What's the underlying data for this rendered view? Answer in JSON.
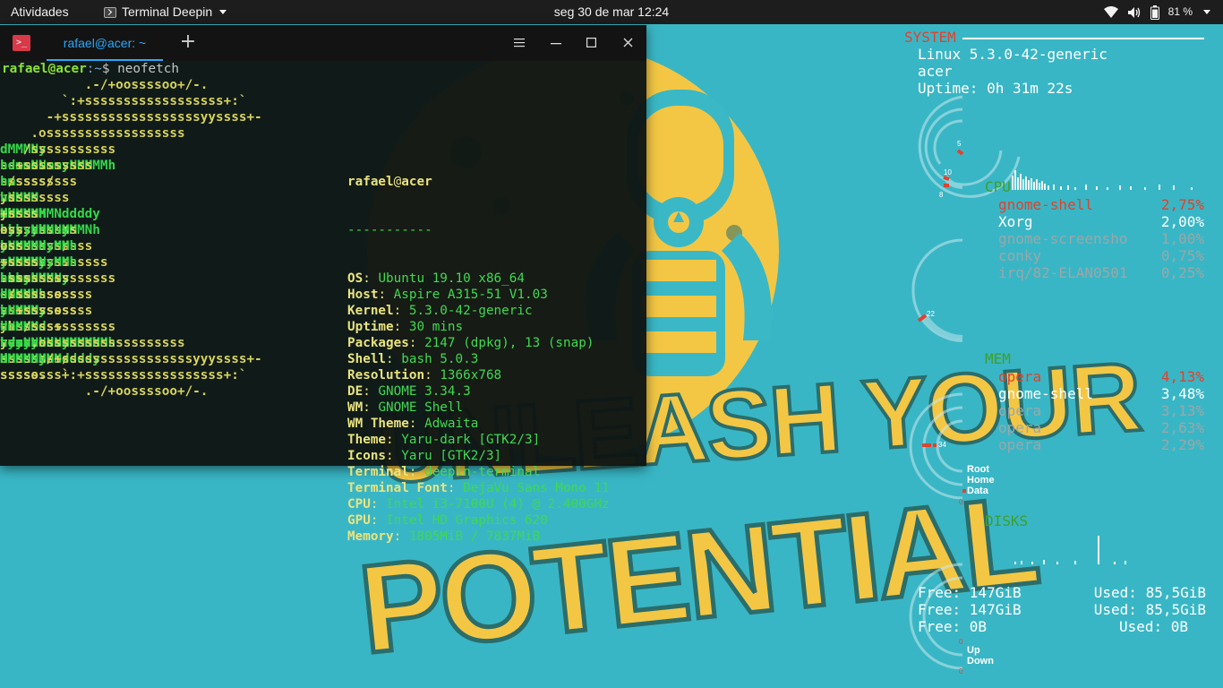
{
  "topbar": {
    "activities": "Atividades",
    "app_name": "Terminal Deepin",
    "clock": "seg 30 de mar  12:24",
    "battery": "81 %",
    "icons": [
      "terminal-app-icon",
      "wifi-icon",
      "volume-icon",
      "battery-icon",
      "chevron-down-icon"
    ]
  },
  "wallpaper": {
    "text_line1": "UNLEASH YOUR",
    "text_line2": "POTENTIAL",
    "colors": {
      "background": "#39b6c5",
      "yellow": "#f3c744",
      "dark": "#1f3a3a"
    }
  },
  "terminal": {
    "tab_title": "rafael@acer: ~",
    "prompt": {
      "user": "rafael@acer",
      "path": ":~",
      "symbol": "$ ",
      "command": "neofetch"
    },
    "logo": [
      [
        [
          "y",
          "           .-/+oossssoo+/-."
        ]
      ],
      [
        [
          "y",
          "        `:+ssssssssssssssssss+:`"
        ]
      ],
      [
        [
          "y",
          "      -+ssssssssssssssssssyyssss+-"
        ]
      ],
      [
        [
          "y",
          "    .ossssssssssssssssss"
        ],
        [
          "g",
          "dMMMNy"
        ],
        [
          "y",
          "sssso."
        ]
      ],
      [
        [
          "y",
          "   /sssssssssss"
        ],
        [
          "g",
          "hdmmNNmmyNMMMMh"
        ],
        [
          "y",
          "ssssss/"
        ]
      ],
      [
        [
          "y",
          "  +sssssssss"
        ],
        [
          "g",
          "hm"
        ],
        [
          "y",
          "yd"
        ],
        [
          "g",
          "MMMMMMMNddddy"
        ],
        [
          "y",
          "ssssssss+"
        ]
      ],
      [
        [
          "y",
          " /ssssssss"
        ],
        [
          "g",
          "hNMMM"
        ],
        [
          "y",
          "yh"
        ],
        [
          "g",
          "hyyyyhmNMMMNh"
        ],
        [
          "y",
          "ssssssss/"
        ]
      ],
      [
        [
          "y",
          ".ssssssss"
        ],
        [
          "g",
          "dMMMNh"
        ],
        [
          "y",
          "ssssssssss"
        ],
        [
          "g",
          "hNMMMd"
        ],
        [
          "y",
          "ssssssss."
        ]
      ],
      [
        [
          "y",
          "+ssss"
        ],
        [
          "g",
          "hhhyNMMNy"
        ],
        [
          "y",
          "ssssssssssss"
        ],
        [
          "g",
          "yNMMMy"
        ],
        [
          "y",
          "sssssss+"
        ]
      ],
      [
        [
          "y",
          "oss"
        ],
        [
          "g",
          "yNMMMNyMMh"
        ],
        [
          "y",
          "ssssssssssssss"
        ],
        [
          "g",
          "hmmmh"
        ],
        [
          "y",
          "ssssssso"
        ]
      ],
      [
        [
          "y",
          "oss"
        ],
        [
          "g",
          "yNMMMNyMMh"
        ],
        [
          "y",
          "sssssssssssssss"
        ],
        [
          "g",
          "hmmmh"
        ],
        [
          "y",
          "ssssssso"
        ]
      ],
      [
        [
          "y",
          "+ssss"
        ],
        [
          "g",
          "hhhyNMMNy"
        ],
        [
          "y",
          "ssssssssssss"
        ],
        [
          "g",
          "yNMMMy"
        ],
        [
          "y",
          "sssssss+"
        ]
      ],
      [
        [
          "y",
          ".ssssssss"
        ],
        [
          "g",
          "dMMMNh"
        ],
        [
          "y",
          "ssssssssss"
        ],
        [
          "g",
          "hNMMMd"
        ],
        [
          "y",
          "ssssssss."
        ]
      ],
      [
        [
          "y",
          " /ssssssss"
        ],
        [
          "g",
          "hNMMM"
        ],
        [
          "y",
          "yh"
        ],
        [
          "g",
          "hyyyyhdNMMMNh"
        ],
        [
          "y",
          "ssssssss/"
        ]
      ],
      [
        [
          "y",
          "  +sssssssss"
        ],
        [
          "g",
          "dm"
        ],
        [
          "y",
          "yd"
        ],
        [
          "g",
          "MMMMMMMMddddy"
        ],
        [
          "y",
          "ssssssss+"
        ]
      ],
      [
        [
          "y",
          "   /sssssssssss"
        ],
        [
          "g",
          "hdmNNNNmyNMMMMh"
        ],
        [
          "y",
          "ssssss/"
        ]
      ],
      [
        [
          "y",
          "    .ossssssssssssssssss"
        ],
        [
          "g",
          "dMMMNy"
        ],
        [
          "y",
          "sssso."
        ]
      ],
      [
        [
          "y",
          "      -+sssssssssssssssssyyyssss+-"
        ]
      ],
      [
        [
          "y",
          "        `:+ssssssssssssssssss+:`"
        ]
      ],
      [
        [
          "y",
          "           .-/+oossssoo+/-."
        ]
      ]
    ],
    "info_user": "rafael",
    "info_at": "@",
    "info_host": "acer",
    "info_separator": "-----------",
    "info": [
      {
        "key": "OS",
        "value": "Ubuntu 19.10 x86_64"
      },
      {
        "key": "Host",
        "value": "Aspire A315-51 V1.03"
      },
      {
        "key": "Kernel",
        "value": "5.3.0-42-generic"
      },
      {
        "key": "Uptime",
        "value": "30 mins"
      },
      {
        "key": "Packages",
        "value": "2147 (dpkg), 13 (snap)"
      },
      {
        "key": "Shell",
        "value": "bash 5.0.3"
      },
      {
        "key": "Resolution",
        "value": "1366x768"
      },
      {
        "key": "DE",
        "value": "GNOME 3.34.3"
      },
      {
        "key": "WM",
        "value": "GNOME Shell"
      },
      {
        "key": "WM Theme",
        "value": "Adwaita"
      },
      {
        "key": "Theme",
        "value": "Yaru-dark [GTK2/3]"
      },
      {
        "key": "Icons",
        "value": "Yaru [GTK2/3]"
      },
      {
        "key": "Terminal",
        "value": "deepin-terminal"
      },
      {
        "key": "Terminal Font",
        "value": "DejaVu Sans Mono 11"
      },
      {
        "key": "CPU",
        "value": "Intel i3-7100U (4) @ 2.400GHz"
      },
      {
        "key": "GPU",
        "value": "Intel HD Graphics 620"
      },
      {
        "key": "Memory",
        "value": "1805MiB / 7837MiB"
      }
    ]
  },
  "conky": {
    "system_title": "SYSTEM",
    "system_lines": [
      "Linux 5.3.0-42-generic",
      "acer",
      "Uptime: 0h 31m 22s"
    ],
    "cpu_label": "CPU",
    "cpu_procs": [
      {
        "name": "gnome-shell",
        "value": "2,75%",
        "color": "#e1422d"
      },
      {
        "name": "Xorg",
        "value": "2,00%",
        "color": "#ffffff"
      },
      {
        "name": "gnome-screensho",
        "value": "1,00%",
        "color": "#9aa7a9"
      },
      {
        "name": "conky",
        "value": "0,75%",
        "color": "#9aa7a9"
      },
      {
        "name": "irq/82-ELAN0501",
        "value": "0,25%",
        "color": "#9aa7a9"
      }
    ],
    "mem_label": "MEM",
    "mem_procs": [
      {
        "name": "opera",
        "value": "4,13%",
        "color": "#e1422d"
      },
      {
        "name": "gnome-shell",
        "value": "3,48%",
        "color": "#ffffff"
      },
      {
        "name": "opera",
        "value": "3,13%",
        "color": "#9aa7a9"
      },
      {
        "name": "opera",
        "value": "2,63%",
        "color": "#9aa7a9"
      },
      {
        "name": "opera",
        "value": "2,29%",
        "color": "#9aa7a9"
      }
    ],
    "disks_label": "DISKS",
    "disks": [
      {
        "free": "Free: 147GiB",
        "used": "Used: 85,5GiB"
      },
      {
        "free": "Free: 147GiB",
        "used": "Used: 85,5GiB"
      },
      {
        "free": "Free: 0B",
        "used": "Used: 0B"
      }
    ],
    "ring1_nums": [
      "5",
      "10",
      "8"
    ],
    "ring2_num": "22",
    "ring3_num": "34",
    "ring3_zero": "0",
    "fs_labels": [
      "Root",
      "Home",
      "Data"
    ],
    "net_labels": [
      "Up",
      "Down"
    ],
    "net_zero_top": "0",
    "net_zero_bottom": "0",
    "colors": {
      "accent": "#e1422d",
      "section": "#3e9f2a",
      "ring": "#c9e9ee"
    }
  }
}
